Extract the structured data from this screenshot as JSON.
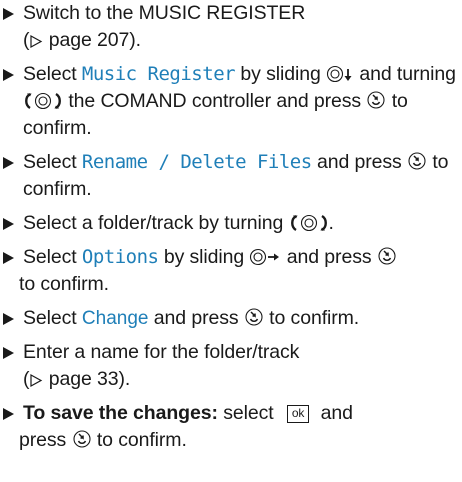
{
  "steps": [
    {
      "a": "Switch to the MUSIC REGISTER",
      "b_pre": "(",
      "b_ref": "page 207).",
      "b_post": ""
    },
    {
      "a": "Select ",
      "term": "Music Register",
      "b": " by sliding ",
      "c": " and turning ",
      "d": " the COMAND controller and press ",
      "e": " to confirm."
    },
    {
      "a": "Select ",
      "term": "Rename / Delete Files",
      "b": " and press ",
      "c": " to confirm."
    },
    {
      "a": "Select a folder/track by turning ",
      "b": "."
    },
    {
      "a": "Select ",
      "term": "Options",
      "b": " by sliding ",
      "c": " and press ",
      "d": " to confirm."
    },
    {
      "a": "Select ",
      "term": "Change",
      "b": " and press ",
      "c": " to confirm."
    },
    {
      "a": "Enter a name for the folder/track",
      "b_pre": "(",
      "b_ref": "page 33)."
    },
    {
      "bold": "To save the changes:",
      "a": " select ",
      "key": "ok",
      "b": " and press ",
      "c": " to confirm."
    }
  ],
  "icons": {
    "bullet": "triangle-bullet-icon",
    "slide_down": "controller-slide-down-icon",
    "slide_right": "controller-slide-right-icon",
    "turn": "controller-turn-icon",
    "press": "controller-press-icon",
    "page_ref": "page-reference-arrow-icon"
  },
  "colors": {
    "text": "#1a1a1a",
    "ui_term": "#1f7fb8"
  }
}
